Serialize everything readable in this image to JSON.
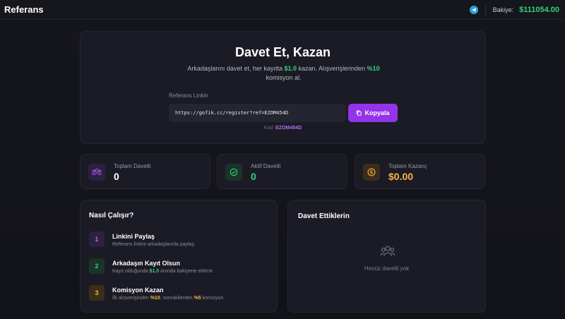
{
  "header": {
    "title": "Referans",
    "telegram_icon": "telegram-icon",
    "balance_label": "Bakiye:",
    "balance_value": "$111054.00"
  },
  "hero": {
    "title": "Davet Et, Kazan",
    "desc_part1": "Arkadaşlarını davet et, her kayıtta ",
    "signup_reward": "$1.0",
    "desc_part2": " kazan. Alışverişlerinden ",
    "commission": "%10",
    "desc_part3": " komisyon al.",
    "link_label": "Referans Linkin",
    "link_value": "https://gofik.cc/register?ref=EZOM454D",
    "copy_label": "Kopyala",
    "code_label": "Kod:",
    "code_value": "EZOM454D"
  },
  "stats": [
    {
      "label": "Toplam Davetli",
      "value": "0",
      "icon": "users-icon",
      "color": "#a855f7"
    },
    {
      "label": "Aktif Davetli",
      "value": "0",
      "icon": "check-circle-icon",
      "color": "#34d27b"
    },
    {
      "label": "Toplam Kazanç",
      "value": "$0.00",
      "icon": "dollar-coin-icon",
      "color": "#f5b642"
    }
  ],
  "how": {
    "title": "Nasıl Çalışır?",
    "steps": [
      {
        "num": "1",
        "title": "Linkini Paylaş",
        "desc": "Referans linkini arkadaşlarınla paylaş."
      },
      {
        "num": "2",
        "title": "Arkadaşın Kayıt Olsun",
        "desc_a": "Kayıt olduğunda ",
        "reward": "$1.0",
        "desc_b": " anında bakiyene eklenir."
      },
      {
        "num": "3",
        "title": "Komisyon Kazan",
        "desc_a": "İlk alışverişinden ",
        "first": "%10",
        "desc_b": ", sonrakilerden ",
        "later": "%5",
        "desc_c": " komisyon."
      }
    ]
  },
  "invites": {
    "title": "Davet Ettiklerin",
    "empty_text": "Henüz davetli yok"
  },
  "colors": {
    "accent": "#9333ea",
    "green": "#34d27b",
    "gold": "#f5b642",
    "background": "#15151c"
  }
}
